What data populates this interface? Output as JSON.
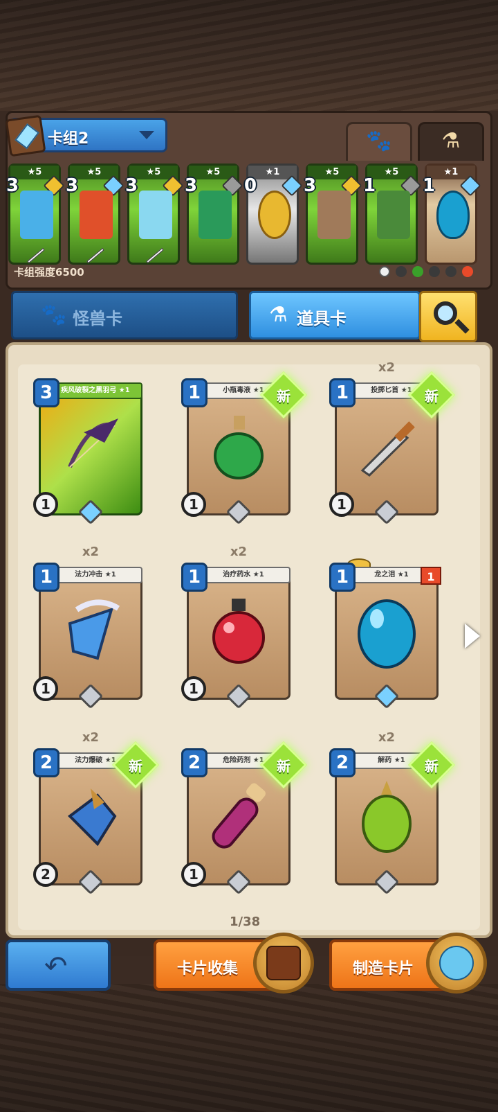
{
  "deck": {
    "name": "卡组2",
    "power_label": "卡组强度6500",
    "slots": [
      {
        "stars": "★5",
        "cost": "3",
        "frame": "green",
        "gem": "#f0c030",
        "art": "seahorse-staff"
      },
      {
        "stars": "★5",
        "cost": "3",
        "frame": "green",
        "gem": "#7ad0ff",
        "art": "fire-feather"
      },
      {
        "stars": "★5",
        "cost": "3",
        "frame": "green",
        "gem": "#f0c030",
        "art": "spear"
      },
      {
        "stars": "★5",
        "cost": "3",
        "frame": "green",
        "gem": "#9a9a9a",
        "art": "emerald-ring"
      },
      {
        "stars": "★1",
        "cost": "0",
        "frame": "gray",
        "gem": "#7ad0ff",
        "art": "gold-coin"
      },
      {
        "stars": "★5",
        "cost": "3",
        "frame": "green",
        "gem": "#f0c030",
        "art": "armor"
      },
      {
        "stars": "★5",
        "cost": "1",
        "frame": "green",
        "gem": "#9a9a9a",
        "art": "green-tunic"
      },
      {
        "stars": "★1",
        "cost": "1",
        "frame": "tan",
        "gem": "#7ad0ff",
        "art": "dragon-egg"
      }
    ]
  },
  "tabs": {
    "monster_label": "怪兽卡",
    "item_label": "道具卡"
  },
  "cards": [
    {
      "title": "疾风破裂之黑羽弓 ★1",
      "cost": "3",
      "speed": "1",
      "count": "",
      "new": false,
      "style": "green",
      "art_color": "#6b4a8a"
    },
    {
      "title": "小瓶毒液 ★1",
      "cost": "1",
      "speed": "1",
      "count": "",
      "new": true,
      "new_label": "新",
      "style": "tan",
      "art_color": "#2ea84a"
    },
    {
      "title": "投掷匕首 ★1",
      "cost": "1",
      "speed": "1",
      "count": "x2",
      "new": true,
      "new_label": "新",
      "style": "tan",
      "art_color": "#c8c8c8"
    },
    {
      "title": "法力冲击 ★1",
      "cost": "1",
      "speed": "1",
      "count": "x2",
      "new": false,
      "style": "tan",
      "art_color": "#4a9ae8"
    },
    {
      "title": "治疗药水 ★1",
      "cost": "1",
      "speed": "1",
      "count": "x2",
      "new": false,
      "style": "tan",
      "art_color": "#d8283a"
    },
    {
      "title": "龙之泪 ★1",
      "cost": "1",
      "speed": "",
      "count": "",
      "new": false,
      "style": "tan",
      "art_color": "#1aa0d0",
      "flag": "1"
    },
    {
      "title": "法力爆破 ★1",
      "cost": "2",
      "speed": "2",
      "count": "x2",
      "new": true,
      "new_label": "新",
      "style": "tan",
      "art_color": "#3a7ad0"
    },
    {
      "title": "危险药剂 ★1",
      "cost": "2",
      "speed": "1",
      "count": "",
      "new": true,
      "new_label": "新",
      "style": "tan",
      "art_color": "#b0307a"
    },
    {
      "title": "解药 ★1",
      "cost": "2",
      "speed": "",
      "count": "x2",
      "new": true,
      "new_label": "新",
      "style": "tan",
      "art_color": "#8ac82a"
    }
  ],
  "pagination": "1/38",
  "buttons": {
    "collect_label": "卡片收集",
    "craft_label": "制造卡片"
  }
}
